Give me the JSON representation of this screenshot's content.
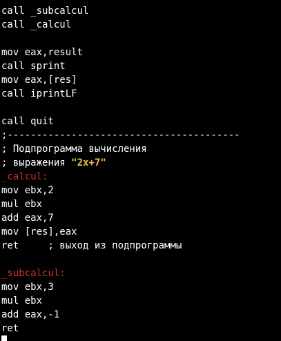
{
  "editor": {
    "colors": {
      "background": "#000000",
      "text": "#ffffff",
      "label": "#d2322d",
      "string": "#f0c24a"
    },
    "lines": [
      {
        "segments": [
          {
            "text": "call _subcalcul",
            "kind": "code"
          }
        ]
      },
      {
        "segments": [
          {
            "text": "call _calcul",
            "kind": "code"
          }
        ]
      },
      {
        "segments": [
          {
            "text": "",
            "kind": "code"
          }
        ]
      },
      {
        "segments": [
          {
            "text": "mov eax,result",
            "kind": "code"
          }
        ]
      },
      {
        "segments": [
          {
            "text": "call sprint",
            "kind": "code"
          }
        ]
      },
      {
        "segments": [
          {
            "text": "mov eax,[res]",
            "kind": "code"
          }
        ]
      },
      {
        "segments": [
          {
            "text": "call iprintLF",
            "kind": "code"
          }
        ]
      },
      {
        "segments": [
          {
            "text": "",
            "kind": "code"
          }
        ]
      },
      {
        "segments": [
          {
            "text": "call quit",
            "kind": "code"
          }
        ]
      },
      {
        "segments": [
          {
            "text": ";----------------------------------------",
            "kind": "comment"
          }
        ]
      },
      {
        "segments": [
          {
            "text": "; Подпрограмма вычисления",
            "kind": "comment"
          }
        ]
      },
      {
        "segments": [
          {
            "text": "; выражения ",
            "kind": "comment"
          },
          {
            "text": "\"2x+7\"",
            "kind": "string"
          }
        ]
      },
      {
        "segments": [
          {
            "text": "_calcul:",
            "kind": "label"
          }
        ]
      },
      {
        "segments": [
          {
            "text": "mov ebx,2",
            "kind": "code"
          }
        ]
      },
      {
        "segments": [
          {
            "text": "mul ebx",
            "kind": "code"
          }
        ]
      },
      {
        "segments": [
          {
            "text": "add eax,7",
            "kind": "code"
          }
        ]
      },
      {
        "segments": [
          {
            "text": "mov [res],eax",
            "kind": "code"
          }
        ]
      },
      {
        "segments": [
          {
            "text": "ret     ",
            "kind": "code"
          },
          {
            "text": "; выход из подпрограммы",
            "kind": "comment"
          }
        ]
      },
      {
        "segments": [
          {
            "text": "",
            "kind": "code"
          }
        ]
      },
      {
        "segments": [
          {
            "text": "_subcalcul:",
            "kind": "label"
          }
        ]
      },
      {
        "segments": [
          {
            "text": "mov ebx,3",
            "kind": "code"
          }
        ]
      },
      {
        "segments": [
          {
            "text": "mul ebx",
            "kind": "code"
          }
        ]
      },
      {
        "segments": [
          {
            "text": "add eax,-1",
            "kind": "code"
          }
        ]
      },
      {
        "segments": [
          {
            "text": "ret",
            "kind": "code"
          }
        ]
      }
    ]
  }
}
